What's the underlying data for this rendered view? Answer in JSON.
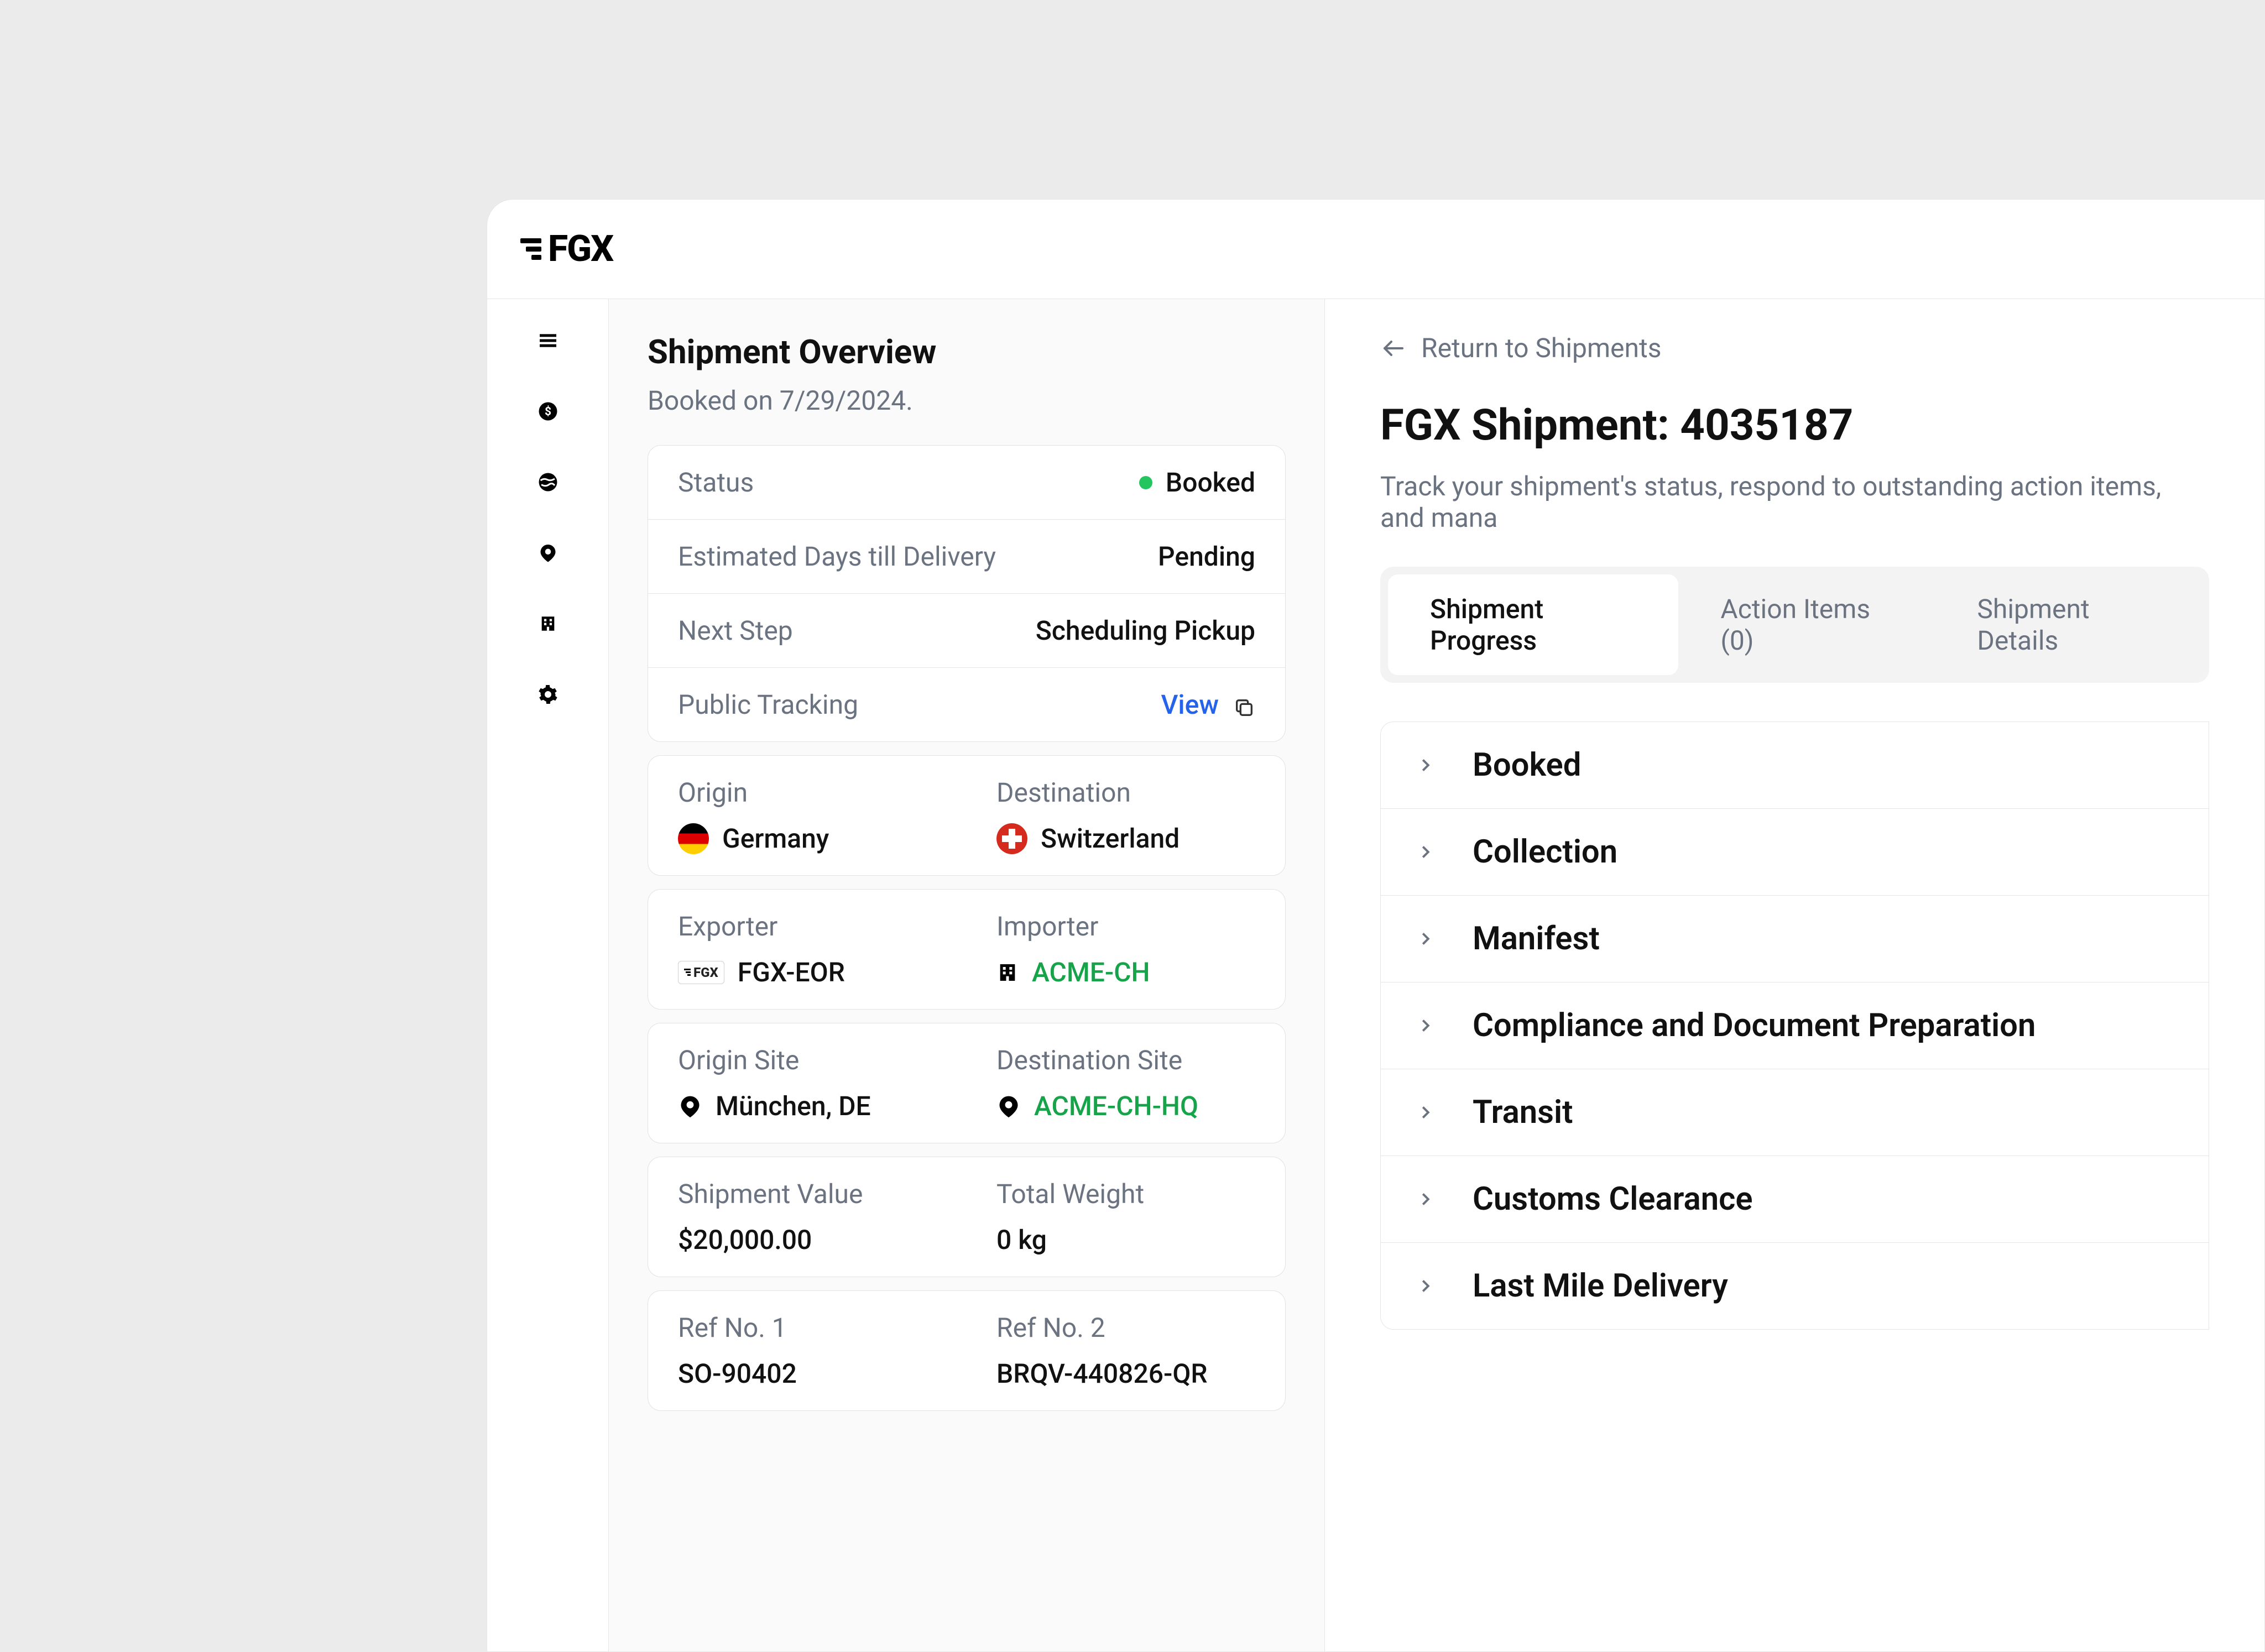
{
  "logo": "FGX",
  "overview": {
    "title": "Shipment Overview",
    "booked_on": "Booked on 7/29/2024.",
    "status_label": "Status",
    "status_value": "Booked",
    "eta_label": "Estimated Days till Delivery",
    "eta_value": "Pending",
    "next_step_label": "Next Step",
    "next_step_value": "Scheduling Pickup",
    "tracking_label": "Public Tracking",
    "tracking_action": "View",
    "origin": {
      "label": "Origin",
      "value": "Germany"
    },
    "destination": {
      "label": "Destination",
      "value": "Switzerland"
    },
    "exporter": {
      "label": "Exporter",
      "value": "FGX-EOR"
    },
    "importer": {
      "label": "Importer",
      "value": "ACME-CH"
    },
    "origin_site": {
      "label": "Origin Site",
      "value": "München, DE"
    },
    "destination_site": {
      "label": "Destination Site",
      "value": "ACME-CH-HQ"
    },
    "value": {
      "label": "Shipment Value",
      "value": "$20,000.00"
    },
    "weight": {
      "label": "Total Weight",
      "value": "0 kg"
    },
    "ref1": {
      "label": "Ref No. 1",
      "value": "SO-90402"
    },
    "ref2": {
      "label": "Ref No. 2",
      "value": "BRQV-440826-QR"
    }
  },
  "main": {
    "return_label": "Return to Shipments",
    "title": "FGX Shipment: 4035187",
    "description": "Track your shipment's status, respond to outstanding action items, and mana",
    "tabs": {
      "progress": "Shipment Progress",
      "action_items": "Action Items (0)",
      "details": "Shipment Details"
    },
    "steps": {
      "booked": "Booked",
      "collection": "Collection",
      "manifest": "Manifest",
      "compliance": "Compliance and Document Preparation",
      "transit": "Transit",
      "customs": "Customs Clearance",
      "lastmile": "Last Mile Delivery"
    }
  }
}
